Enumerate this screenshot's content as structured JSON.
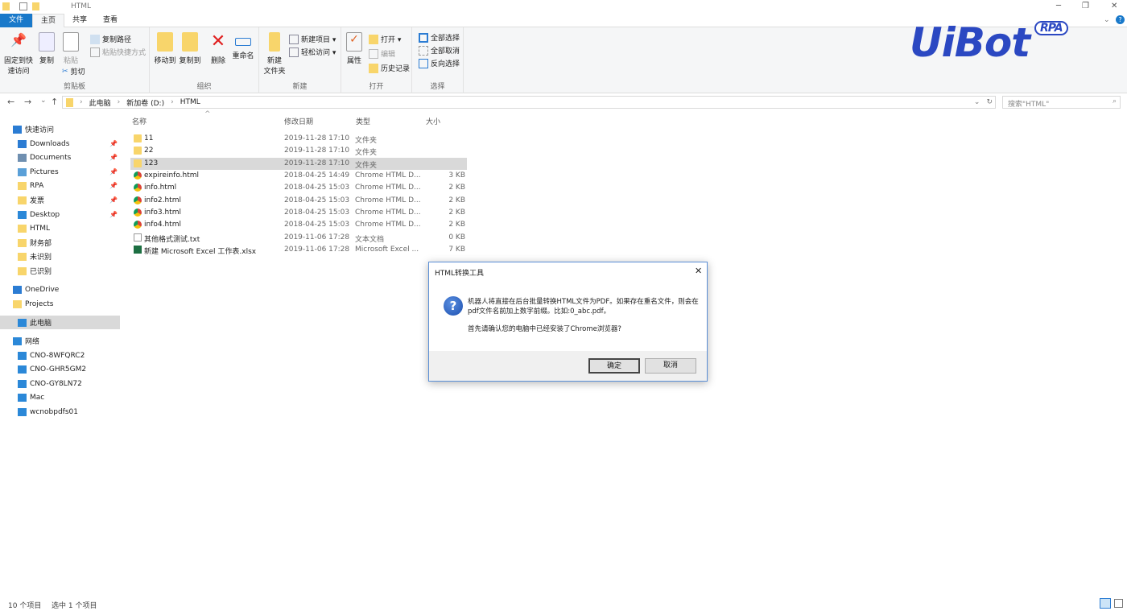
{
  "window": {
    "title": "HTML",
    "minimize": "─",
    "maximize": "❐",
    "close": "✕"
  },
  "tabs": [
    {
      "label": "文件"
    },
    {
      "label": "主页"
    },
    {
      "label": "共享"
    },
    {
      "label": "查看"
    }
  ],
  "ribbon": {
    "clipboard": {
      "label": "剪贴板",
      "pin": "固定到快\n速访问",
      "copy": "复制",
      "paste": "粘贴",
      "copy_path": "复制路径",
      "paste_shortcut": "粘贴快捷方式",
      "cut": "剪切"
    },
    "organize": {
      "label": "组织",
      "move_to": "移动到",
      "copy_to": "复制到",
      "delete": "删除",
      "rename": "重命名"
    },
    "new": {
      "label": "新建",
      "new_folder": "新建\n文件夹",
      "new_item": "新建项目 ▾",
      "easy_access": "轻松访问 ▾"
    },
    "open": {
      "label": "打开",
      "properties": "属性",
      "open": "打开 ▾",
      "edit": "编辑",
      "history": "历史记录"
    },
    "select": {
      "label": "选择",
      "select_all": "全部选择",
      "select_none": "全部取消",
      "invert": "反向选择"
    }
  },
  "address": {
    "crumbs": [
      "此电脑",
      "新加卷 (D:)",
      "HTML"
    ],
    "search_placeholder": "搜索\"HTML\""
  },
  "sidebar": [
    {
      "label": "快速访问",
      "icon": "star-icon",
      "color": "#2b7cd3"
    },
    {
      "label": "Downloads",
      "icon": "download-icon",
      "color": "#2b7cd3",
      "pinned": true
    },
    {
      "label": "Documents",
      "icon": "documents-icon",
      "color": "#6f8fb0",
      "pinned": true
    },
    {
      "label": "Pictures",
      "icon": "pictures-icon",
      "color": "#5aa0d8",
      "pinned": true
    },
    {
      "label": "RPA",
      "icon": "folder-icon",
      "color": "#f8d56b",
      "pinned": true
    },
    {
      "label": "发票",
      "icon": "folder-icon",
      "color": "#f8d56b",
      "pinned": true
    },
    {
      "label": "Desktop",
      "icon": "desktop-icon",
      "color": "#2b88d8",
      "pinned": true
    },
    {
      "label": "HTML",
      "icon": "folder-icon",
      "color": "#f8d56b"
    },
    {
      "label": "财务部",
      "icon": "folder-icon",
      "color": "#f8d56b"
    },
    {
      "label": "未识别",
      "icon": "folder-icon",
      "color": "#f8d56b"
    },
    {
      "label": "已识别",
      "icon": "folder-icon",
      "color": "#f8d56b"
    },
    {
      "label": "OneDrive",
      "icon": "cloud-icon",
      "color": "#2b7cd3"
    },
    {
      "label": "Projects",
      "icon": "folder-icon",
      "color": "#f8d56b"
    },
    {
      "label": "此电脑",
      "icon": "computer-icon",
      "color": "#2b88d8",
      "selected": true
    },
    {
      "label": "网络",
      "icon": "network-icon",
      "color": "#2b88d8"
    },
    {
      "label": "CNO-8WFQRC2",
      "icon": "computer-icon",
      "color": "#2b88d8"
    },
    {
      "label": "CNO-GHR5GM2",
      "icon": "computer-icon",
      "color": "#2b88d8"
    },
    {
      "label": "CNO-GY8LN72",
      "icon": "computer-icon",
      "color": "#2b88d8"
    },
    {
      "label": "Mac",
      "icon": "computer-icon",
      "color": "#2b88d8"
    },
    {
      "label": "wcnobpdfs01",
      "icon": "computer-icon",
      "color": "#2b88d8"
    }
  ],
  "columns": {
    "name": "名称",
    "date": "修改日期",
    "type": "类型",
    "size": "大小"
  },
  "files": [
    {
      "name": "11",
      "date": "2019-11-28 17:10",
      "type": "文件夹",
      "size": "",
      "icon": "folder"
    },
    {
      "name": "22",
      "date": "2019-11-28 17:10",
      "type": "文件夹",
      "size": "",
      "icon": "folder"
    },
    {
      "name": "123",
      "date": "2019-11-28 17:10",
      "type": "文件夹",
      "size": "",
      "icon": "folder",
      "selected": true
    },
    {
      "name": "expireinfo.html",
      "date": "2018-04-25 14:49",
      "type": "Chrome HTML D...",
      "size": "3 KB",
      "icon": "chrome"
    },
    {
      "name": "info.html",
      "date": "2018-04-25 15:03",
      "type": "Chrome HTML D...",
      "size": "2 KB",
      "icon": "chrome"
    },
    {
      "name": "info2.html",
      "date": "2018-04-25 15:03",
      "type": "Chrome HTML D...",
      "size": "2 KB",
      "icon": "chrome"
    },
    {
      "name": "info3.html",
      "date": "2018-04-25 15:03",
      "type": "Chrome HTML D...",
      "size": "2 KB",
      "icon": "chrome"
    },
    {
      "name": "info4.html",
      "date": "2018-04-25 15:03",
      "type": "Chrome HTML D...",
      "size": "2 KB",
      "icon": "chrome"
    },
    {
      "name": "其他格式测试.txt",
      "date": "2019-11-06 17:28",
      "type": "文本文档",
      "size": "0 KB",
      "icon": "txt"
    },
    {
      "name": "新建 Microsoft Excel 工作表.xlsx",
      "date": "2019-11-06 17:28",
      "type": "Microsoft Excel ...",
      "size": "7 KB",
      "icon": "xls"
    }
  ],
  "dialog": {
    "title": "HTML转换工具",
    "line1": "机器人将直接在后台批量转换HTML文件为PDF。如果存在重名文件，则会在",
    "line2": "pdf文件名前加上数字前缀。比如:0_abc.pdf。",
    "line3": "首先请确认您的电脑中已经安装了Chrome浏览器?",
    "ok": "确定",
    "cancel": "取消",
    "close": "✕"
  },
  "status": {
    "count": "10 个项目",
    "selected": "选中 1 个项目"
  },
  "logo": {
    "text": "UiBot",
    "badge": "RPA",
    "color": "#2b48c2"
  }
}
